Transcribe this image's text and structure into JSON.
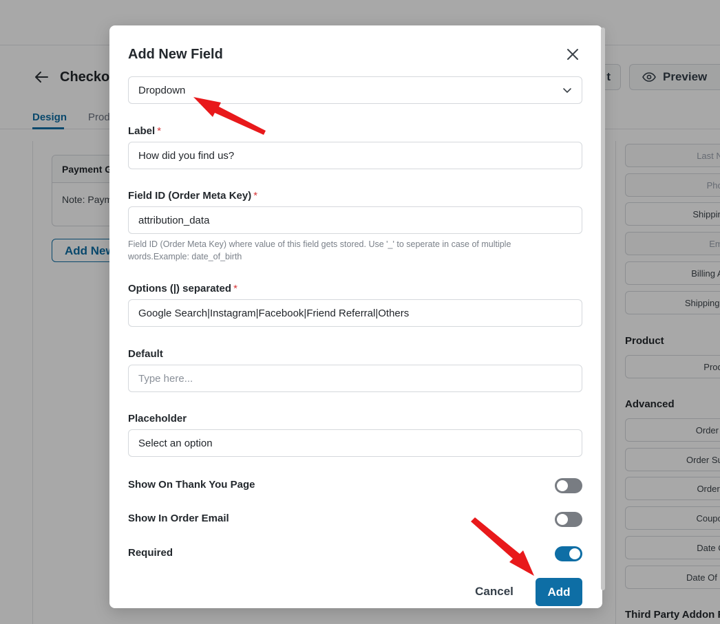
{
  "background": {
    "page_title": "Checkout",
    "buttons": {
      "partial_label": "t",
      "preview_label": "Preview"
    },
    "tabs": [
      {
        "label": "Design",
        "active": true
      },
      {
        "label": "Prod",
        "active": false
      }
    ],
    "card": {
      "header": "Payment G",
      "body": "Note: Paym"
    },
    "add_new_label": "Add New",
    "sidebar": {
      "items_top": [
        "Last Na",
        "Phon",
        "Shipping",
        "Ema",
        "Billing Ac",
        "Shipping A"
      ],
      "product_heading": "Product",
      "product_items": [
        "Produ"
      ],
      "advanced_heading": "Advanced",
      "advanced_items": [
        "Order N",
        "Order Sun",
        "Order T",
        "Coupon",
        "Date Of",
        "Date Of Bi"
      ],
      "third_party_heading": "Third Party Addon Fi"
    }
  },
  "modal": {
    "title": "Add New Field",
    "field_type": {
      "selected": "Dropdown"
    },
    "label_field": {
      "label": "Label",
      "required_mark": "*",
      "value": "How did you find us?"
    },
    "field_id": {
      "label": "Field ID (Order Meta Key)",
      "required_mark": "*",
      "value": "attribution_data",
      "help": "Field ID (Order Meta Key) where value of this field gets stored. Use '_' to seperate in case of multiple words.Example: date_of_birth"
    },
    "options": {
      "label": "Options (|) separated",
      "required_mark": "*",
      "value": "Google Search|Instagram|Facebook|Friend Referral|Others"
    },
    "default_field": {
      "label": "Default",
      "placeholder": "Type here..."
    },
    "placeholder_field": {
      "label": "Placeholder",
      "value": "Select an option"
    },
    "toggles": [
      {
        "label": "Show On Thank You Page",
        "on": false
      },
      {
        "label": "Show In Order Email",
        "on": false
      },
      {
        "label": "Required",
        "on": true
      }
    ],
    "cancel_label": "Cancel",
    "add_label": "Add"
  },
  "colors": {
    "accent": "#0e6ea5",
    "required": "#d63638",
    "annotation_arrow": "#e8191b"
  }
}
